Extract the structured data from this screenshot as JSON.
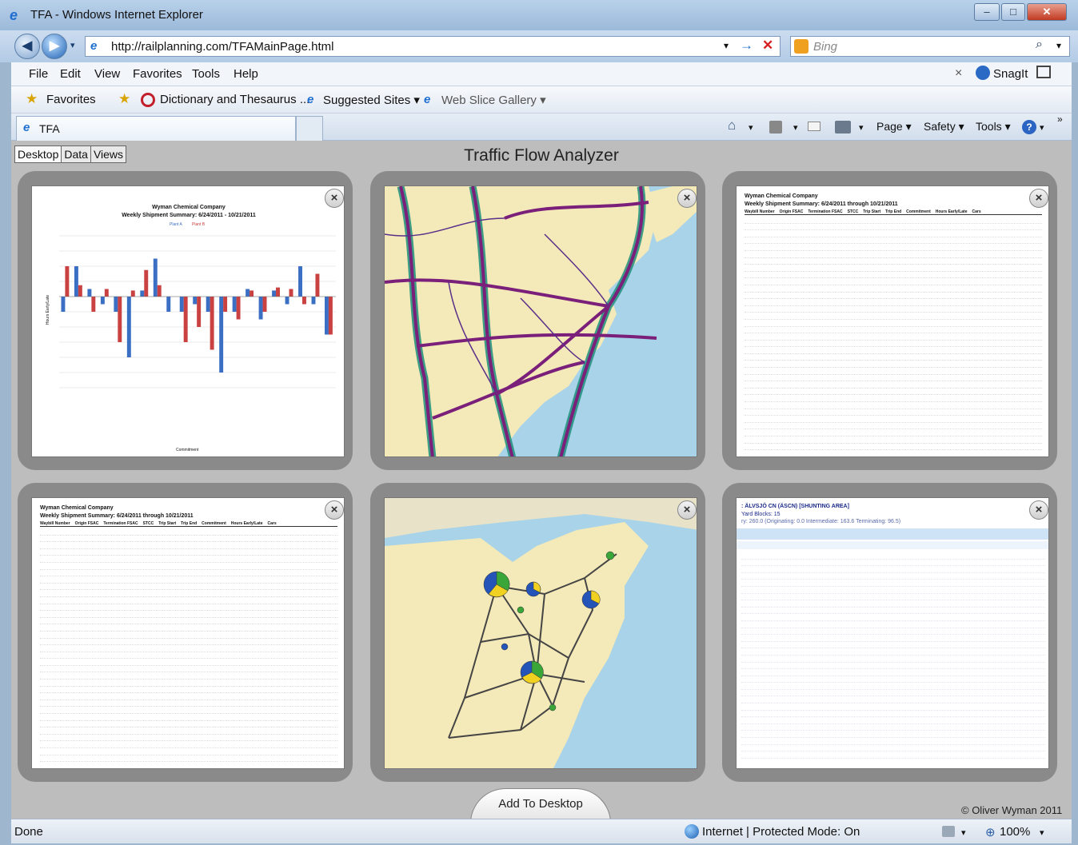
{
  "window": {
    "title": "TFA - Windows Internet Explorer",
    "minimize": "–",
    "maximize": "□",
    "close": "✕"
  },
  "address_bar": {
    "url": "http://railplanning.com/TFAMainPage.html",
    "search_placeholder": "Bing"
  },
  "menu": [
    "File",
    "Edit",
    "View",
    "Favorites",
    "Tools",
    "Help"
  ],
  "snagit": "SnagIt",
  "favorites_bar": {
    "favorites": "Favorites",
    "items": [
      "Dictionary and Thesaurus ...",
      "Suggested Sites ▾",
      "Web Slice Gallery ▾"
    ]
  },
  "tab": {
    "label": "TFA"
  },
  "command_bar": [
    "Page ▾",
    "Safety ▾",
    "Tools ▾"
  ],
  "page_tabs": [
    "Desktop",
    "Data",
    "Views"
  ],
  "app_title": "Traffic Flow Analyzer",
  "panels": {
    "chart": {
      "company": "Wyman Chemical Company",
      "subtitle": "Weekly Shipment Summary: 6/24/2011 - 10/21/2011",
      "legend": [
        "Plant A",
        "Plant B"
      ],
      "xlabel": "Commitment",
      "ylabel": "Hours Early/Late"
    },
    "table": {
      "company": "Wyman Chemical Company",
      "subtitle": "Weekly Shipment Summary: 6/24/2011 through 10/21/2011",
      "columns": [
        "Waybill Number",
        "Origin FSAC",
        "Termination FSAC",
        "STCC",
        "Trip Start",
        "Trip End",
        "Commitment",
        "Hours Early/Late",
        "Cars"
      ]
    },
    "yard": {
      "title": ": ÄLVSJÖ CN (ÄSCN) [SHUNTING AREA]",
      "blocks": "Yard Blocks: 15",
      "stats": "ry: 260.0 (Originating: 0.0  Intermediate: 163.6  Terminating: 96.5)"
    }
  },
  "chart_data": {
    "type": "bar",
    "title": "Weekly Shipment Summary: 6/24/2011 - 10/21/2011",
    "xlabel": "Commitment",
    "ylabel": "Hours Early/Late",
    "ylim": [
      -12,
      8
    ],
    "series": [
      {
        "name": "Plant A",
        "color": "#3b6fc4",
        "values": [
          -2,
          4,
          1,
          -1,
          -2,
          -8,
          0.8,
          5,
          -2,
          -2,
          -1,
          -2,
          -10,
          -2,
          1,
          -3,
          0.8,
          -1,
          4,
          -1,
          -5
        ]
      },
      {
        "name": "Plant B",
        "color": "#c94141",
        "values": [
          4,
          1.5,
          -2,
          1,
          -6,
          0.8,
          3.5,
          1.5,
          0,
          -6,
          -4,
          -7,
          -2,
          -3,
          0.8,
          -2,
          1.2,
          1,
          -1,
          3,
          -5
        ]
      }
    ]
  },
  "add_to_desktop": "Add To Desktop",
  "copyright": "© Oliver Wyman 2011",
  "status": {
    "left": "Done",
    "zone": "Internet | Protected Mode: On",
    "zoom": "100%"
  }
}
